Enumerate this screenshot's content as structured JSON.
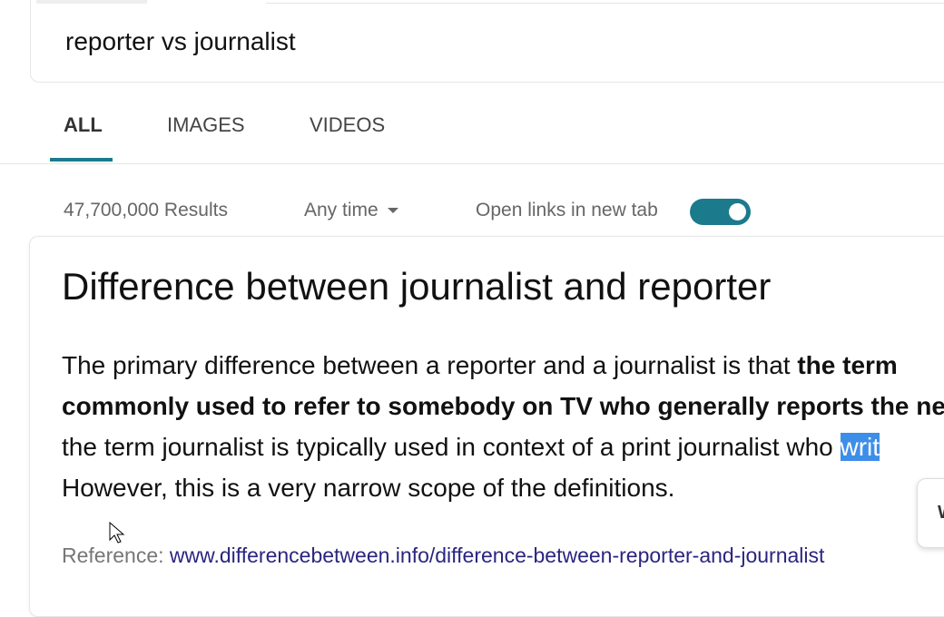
{
  "search": {
    "query": "reporter vs journalist"
  },
  "tabs": [
    {
      "label": "ALL",
      "active": true
    },
    {
      "label": "IMAGES"
    },
    {
      "label": "VIDEOS"
    }
  ],
  "toolbar": {
    "results_count": "47,700,000 Results",
    "time_filter": "Any time",
    "new_tab_label": "Open links in new tab",
    "new_tab_enabled": true
  },
  "answer": {
    "title": "Difference between journalist and reporter",
    "line1_plain": "The primary difference between a reporter and a journalist is that ",
    "line1_bold": "the term",
    "line2_bold": "commonly used to refer to somebody on TV who generally reports the ne",
    "line3_plain": "the term journalist is typically used in context of a print journalist who ",
    "line3_selected": "writ",
    "line4_plain": "However, this is a very narrow scope of the definitions.",
    "reference_label": "Reference: ",
    "reference_link": "www.differencebetween.info/difference-between-reporter-and-journalist"
  },
  "popup": {
    "label": "W"
  },
  "colors": {
    "accent": "#1b7a8c",
    "link": "#2a2580",
    "selection": "#3d8ee8"
  }
}
